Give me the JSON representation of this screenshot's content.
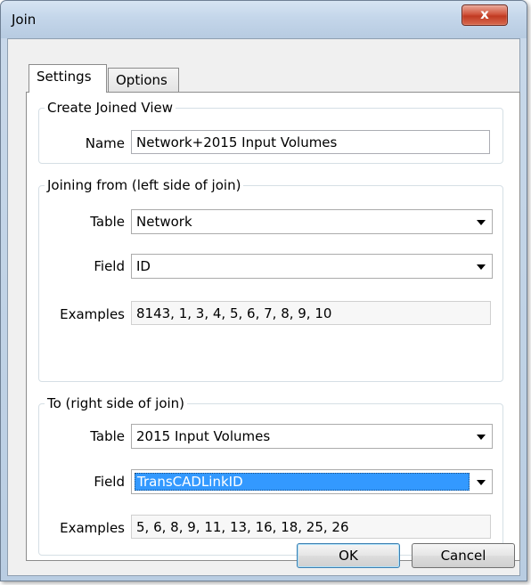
{
  "window": {
    "title": "Join",
    "close_glyph": "x"
  },
  "tabs": [
    {
      "label": "Settings"
    },
    {
      "label": "Options"
    }
  ],
  "groups": {
    "joined_view": {
      "legend": "Create Joined View",
      "name_label": "Name",
      "name_value": "Network+2015 Input Volumes"
    },
    "left": {
      "legend": "Joining from (left side of join)",
      "table_label": "Table",
      "table_value": "Network",
      "field_label": "Field",
      "field_value": "ID",
      "examples_label": "Examples",
      "examples_value": "8143, 1, 3, 4, 5, 6, 7, 8, 9, 10"
    },
    "right": {
      "legend": "To (right side of join)",
      "table_label": "Table",
      "table_value": "2015 Input Volumes",
      "field_label": "Field",
      "field_value": "TransCADLinkID",
      "examples_label": "Examples",
      "examples_value": "5, 6, 8, 9, 11, 13, 16, 18, 25, 26"
    }
  },
  "buttons": {
    "ok": "OK",
    "cancel": "Cancel"
  },
  "colors": {
    "selection": "#3399ff",
    "close_button": "#c03a22"
  }
}
